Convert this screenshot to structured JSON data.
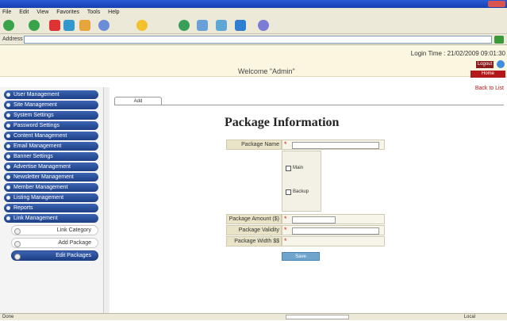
{
  "browser": {
    "title": "",
    "menu": [
      "File",
      "Edit",
      "View",
      "Favorites",
      "Tools",
      "Help"
    ],
    "address_label": "Address",
    "address_value": "",
    "status_text": "Done",
    "zone_text": "Local"
  },
  "header": {
    "breadcrumb": "",
    "login_date": "Login Time : 21/02/2009 09:01:30",
    "welcome_text": "Welcome \"Admin\"",
    "logout_label": "Logout",
    "dashboard_label": "Home Dashboard"
  },
  "sidebar": {
    "nav_items": [
      {
        "label": "User Management"
      },
      {
        "label": "Site Management"
      },
      {
        "label": "System Settings"
      },
      {
        "label": "Password Settings"
      },
      {
        "label": "Content Management"
      },
      {
        "label": "Email Management"
      },
      {
        "label": "Banner Settings"
      },
      {
        "label": "Advertise Management"
      },
      {
        "label": "Newsletter Management"
      },
      {
        "label": "Member Management"
      },
      {
        "label": "Listing Management"
      },
      {
        "label": "Reports"
      },
      {
        "label": "Link Management"
      }
    ],
    "sub_items": [
      {
        "label": "Link Category"
      },
      {
        "label": "Add Package"
      },
      {
        "label": "Edit Packages"
      }
    ]
  },
  "main": {
    "right_link": "Back to List",
    "tab_label": "Add",
    "form_title": "Package Information",
    "fields": {
      "package_name_label": "Package Name",
      "package_type_options": [
        "Main",
        "Backup"
      ],
      "package_amount_label": "Package Amount ($)",
      "package_validity_label": "Package Validity Time",
      "package_width_label": "Package Width $$"
    },
    "save_label": "Save"
  }
}
